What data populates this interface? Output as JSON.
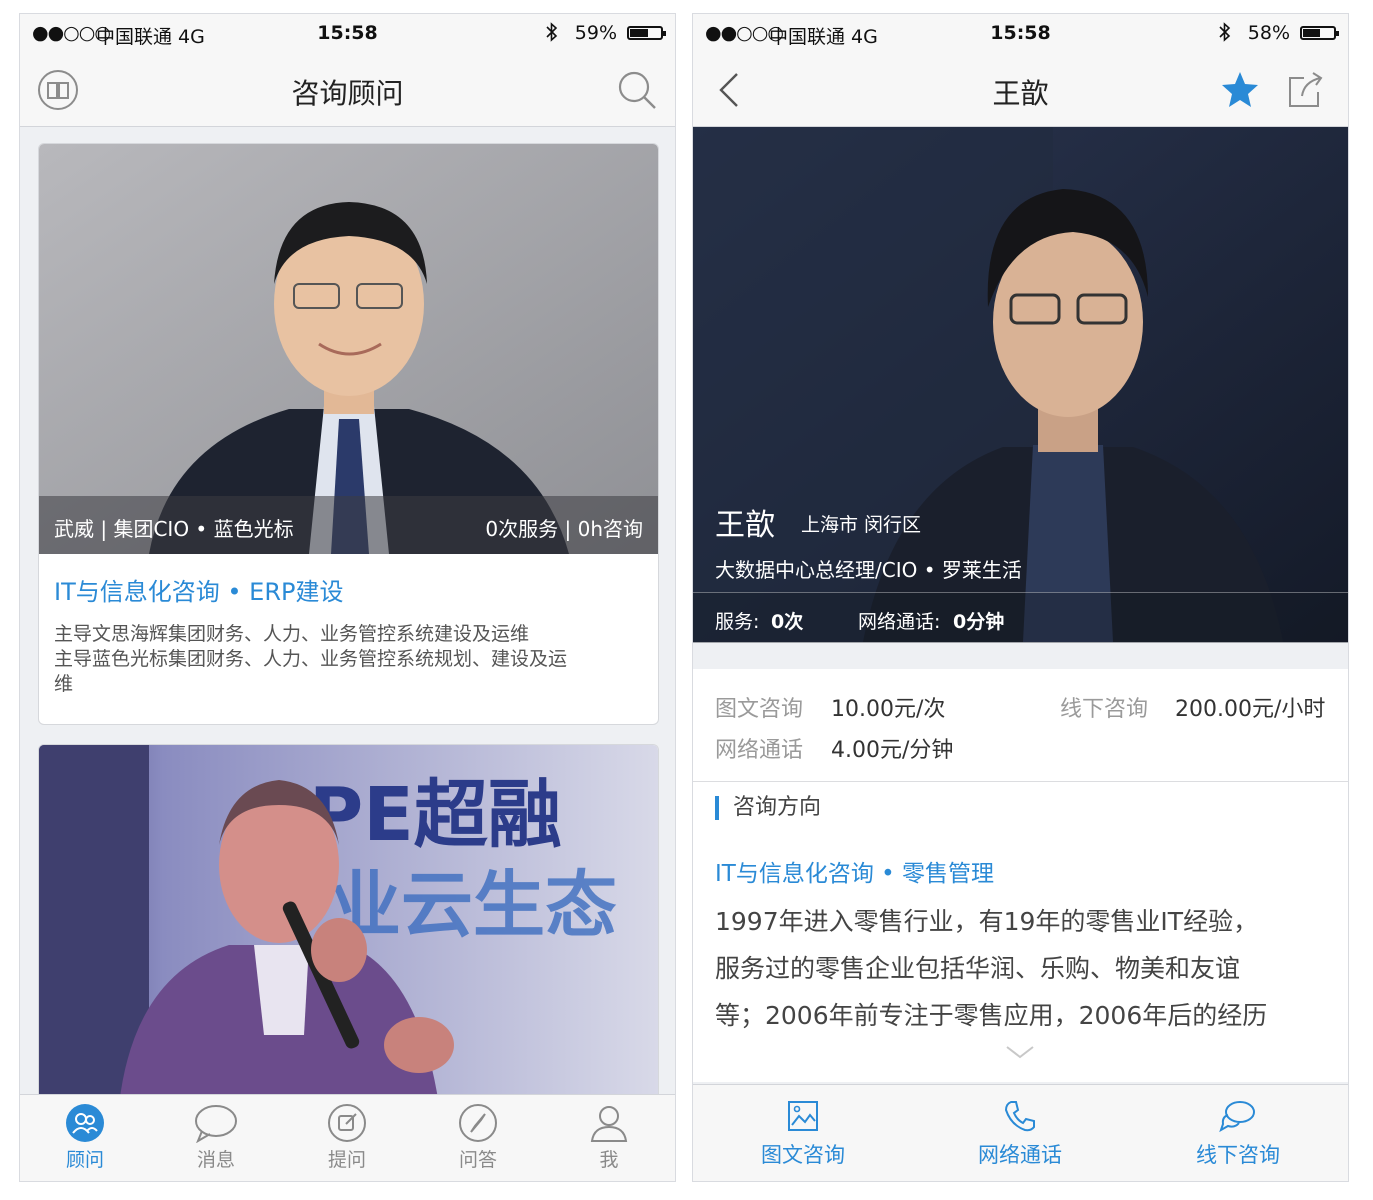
{
  "left": {
    "status": {
      "signal": "●●○○○",
      "carrier": "中国联通  4G",
      "time": "15:58",
      "battery": "59%",
      "battery_level": 0.59
    },
    "nav": {
      "title": "咨询顾问"
    },
    "cards": [
      {
        "caption_left": "武威 | 集团CIO • 蓝色光标",
        "caption_right": "0次服务 | 0h咨询",
        "topic": "IT与信息化咨询 • ERP建设",
        "desc": [
          "主导文思海辉集团财务、人力、业务管控系统建设及运维",
          "主导蓝色光标集团财务、人力、业务管控系统规划、建设及运",
          "维"
        ]
      },
      {
        "banner_text_1": "PE超融",
        "banner_text_2": "业云生态"
      }
    ],
    "tabs": [
      {
        "label": "顾问",
        "icon": "group-icon"
      },
      {
        "label": "消息",
        "icon": "chat-bubble-icon"
      },
      {
        "label": "提问",
        "icon": "compose-icon"
      },
      {
        "label": "问答",
        "icon": "compass-icon"
      },
      {
        "label": "我",
        "icon": "person-icon"
      }
    ],
    "colors": {
      "accent": "#2a8ad6"
    }
  },
  "right": {
    "status": {
      "signal": "●●○○○",
      "carrier": "中国联通  4G",
      "time": "15:58",
      "battery": "58%",
      "battery_level": 0.58
    },
    "nav": {
      "title": "王歆"
    },
    "hero": {
      "name": "王歆",
      "location": "上海市    闵行区",
      "title": "大数据中心总经理/CIO • 罗莱生活",
      "service_label": "服务:",
      "service_value": "0次",
      "call_label": "网络通话:",
      "call_value": "0分钟"
    },
    "prices": {
      "text_label": "图文咨询",
      "text_value": "10.00元/次",
      "offline_label": "线下咨询",
      "offline_value": "200.00元/小时",
      "call_label": "网络通话",
      "call_value": "4.00元/分钟"
    },
    "direction": {
      "heading": "咨询方向",
      "topic": "IT与信息化咨询 • 零售管理",
      "lines": [
        "1997年进入零售行业，有19年的零售业IT经验，",
        "服务过的零售企业包括华润、乐购、物美和友谊",
        "等；2006年前专注于零售应用，2006年后的经历"
      ]
    },
    "actions": [
      {
        "label": "图文咨询",
        "icon": "image-icon"
      },
      {
        "label": "网络通话",
        "icon": "phone-icon"
      },
      {
        "label": "线下咨询",
        "icon": "meeting-chat-icon"
      }
    ]
  }
}
